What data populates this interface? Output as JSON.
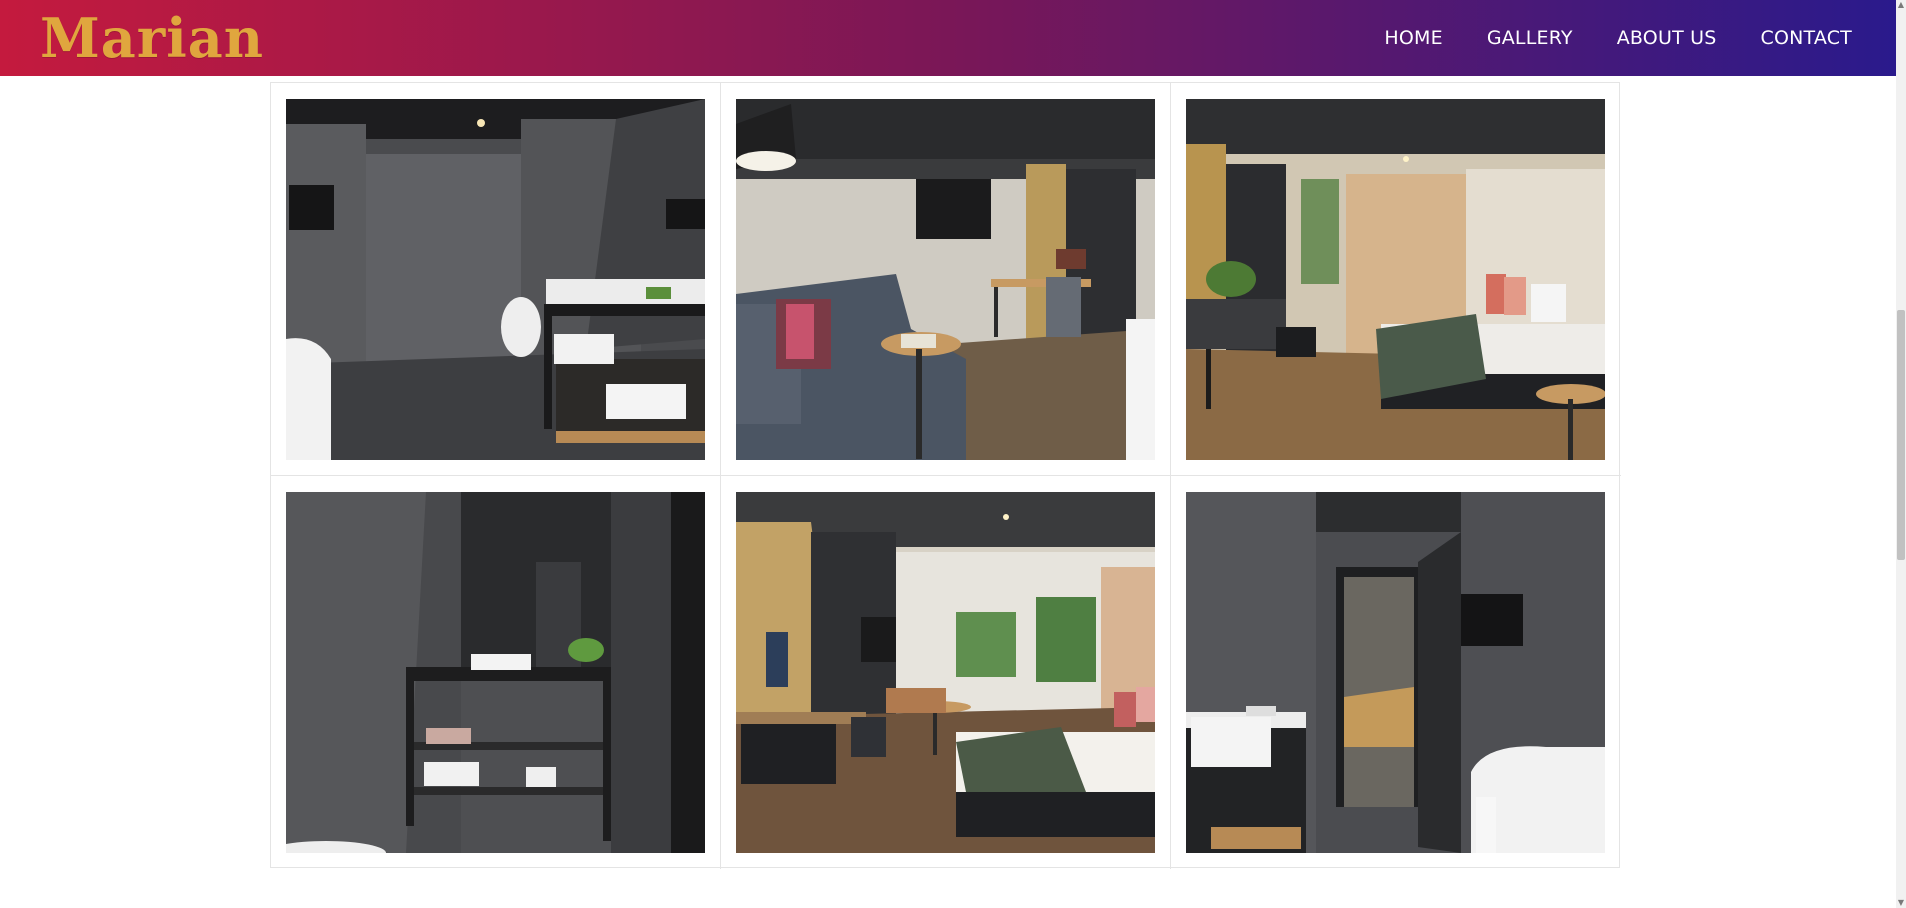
{
  "header": {
    "brand": "Marian",
    "gradient_start": "#c41a3e",
    "gradient_mid": "#7a1757",
    "gradient_end": "#2a1a8c",
    "brand_color": "#e0a63e",
    "nav": [
      {
        "label": "HOME"
      },
      {
        "label": "GALLERY"
      },
      {
        "label": "ABOUT US"
      },
      {
        "label": "CONTACT"
      }
    ]
  },
  "gallery": {
    "photos": [
      {
        "subject": "bathroom-walk-in-shower"
      },
      {
        "subject": "room-sofa-and-desk"
      },
      {
        "subject": "bedroom-with-window"
      },
      {
        "subject": "bathroom-vanity"
      },
      {
        "subject": "bedroom-with-tv-and-windows"
      },
      {
        "subject": "bathroom-bathtub-and-door"
      }
    ]
  },
  "scrollbar": {
    "up_icon": "triangle-up-icon",
    "down_icon": "triangle-down-icon"
  }
}
